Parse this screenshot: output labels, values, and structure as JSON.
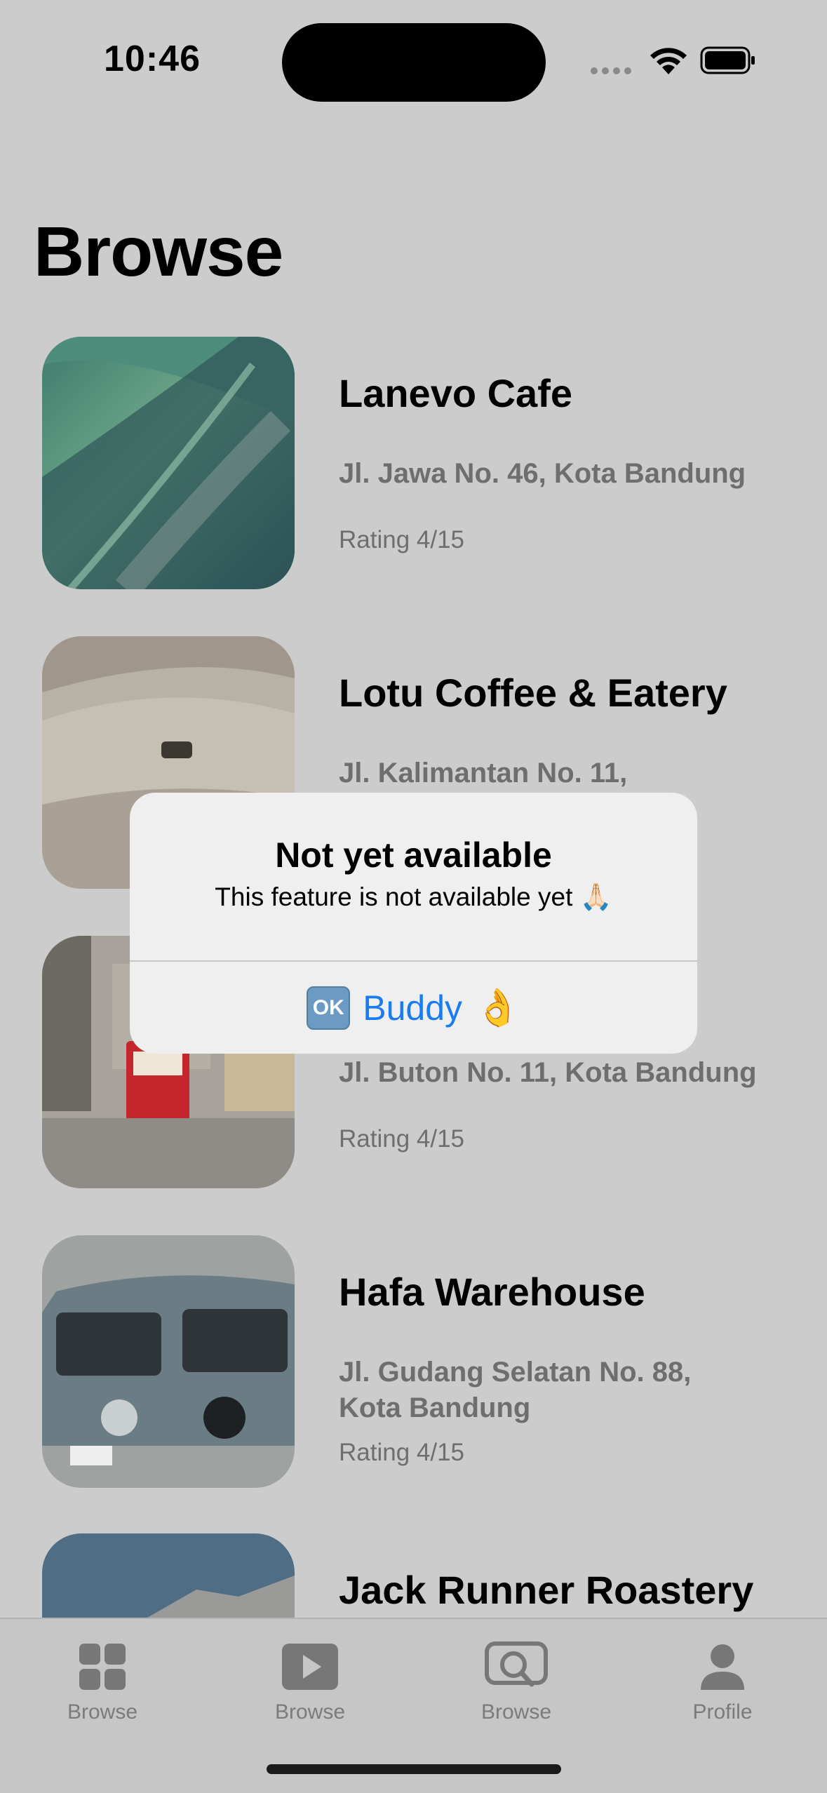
{
  "status_bar": {
    "time": "10:46"
  },
  "page": {
    "title": "Browse"
  },
  "cafes": [
    {
      "name": "Lanevo Cafe",
      "address": "Jl. Jawa No. 46, Kota Bandung",
      "rating": "Rating 4/15",
      "image": "ocean-wave"
    },
    {
      "name": "Lotu Coffee & Eatery",
      "address": "Jl. Kalimantan No. 11, Kota Bandung",
      "rating": "",
      "image": "desert-dunes"
    },
    {
      "name": "",
      "address": "Jl. Buton No. 11, Kota Bandung",
      "rating": "Rating 4/15",
      "image": "city-tram"
    },
    {
      "name": "Hafa Warehouse",
      "address": "Jl. Gudang Selatan No. 88, Kota Bandung",
      "rating": "Rating 4/15",
      "image": "vintage-van"
    },
    {
      "name": "Jack Runner Roastery",
      "address": "",
      "rating": "",
      "image": "mountain"
    }
  ],
  "alert": {
    "title": "Not yet available",
    "message": "This feature is not available yet 🙏🏻",
    "button_ok_glyph": "OK",
    "button_label": "Buddy",
    "button_emoji": "👌"
  },
  "tab_bar": {
    "items": [
      {
        "label": "Browse",
        "icon": "grid-icon"
      },
      {
        "label": "Browse",
        "icon": "play-icon"
      },
      {
        "label": "Browse",
        "icon": "search-chat-icon"
      },
      {
        "label": "Profile",
        "icon": "person-icon"
      }
    ]
  },
  "colors": {
    "accent": "#1a7cf0",
    "background": "#cccccc",
    "secondary_text": "#6e6e6e"
  }
}
